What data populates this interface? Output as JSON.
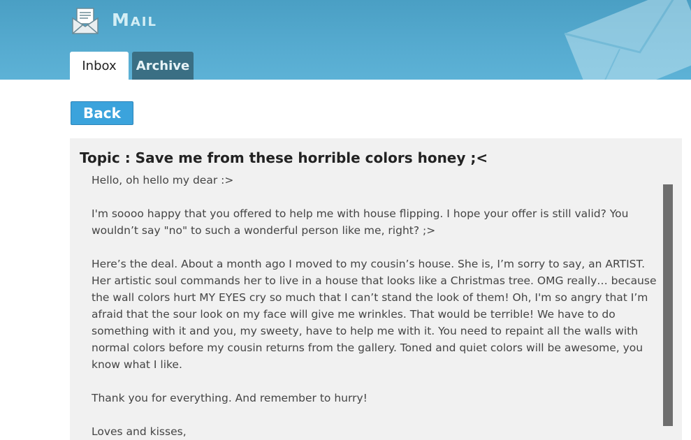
{
  "app": {
    "title": "Mail"
  },
  "tabs": [
    {
      "label": "Inbox",
      "active": true
    },
    {
      "label": "Archive",
      "active": false
    }
  ],
  "toolbar": {
    "back_label": "Back"
  },
  "message": {
    "topic": "Topic : Save me from these horrible colors honey ;<",
    "paragraphs": [
      "Hello, oh hello my dear :>",
      "I'm soooo happy that you offered to help me with house flipping. I hope your offer is still valid? You wouldn’t say \"no\" to such a wonderful person like me, right? ;>",
      "Here’s the deal. About a month ago I moved to my cousin’s house. She is, I’m sorry to say, an ARTIST. Her artistic soul commands her to live in a house that looks like a Christmas tree. OMG really… because the wall colors hurt MY EYES cry so much that I can’t stand the look of them! Oh, I'm so angry that I’m afraid that the sour look on my face will give me wrinkles. That would be terrible! We have to do something with it and you, my sweety, have to help me with it. You need to repaint all the walls with normal colors before my cousin returns from the gallery. Toned and quiet colors will be awesome, you know what I like.",
      "Thank you for everything. And remember to hurry!",
      "Loves and kisses,"
    ]
  },
  "colors": {
    "header": "#56abd0",
    "tab_active": "#ffffff",
    "tab_inactive": "#3a6f84",
    "button": "#3ba3dc",
    "panel": "#f1f1f1",
    "scrollbar": "#6e6e6e"
  },
  "icons": {
    "app": "envelope-letter-icon",
    "decoration": "envelope-icon"
  }
}
